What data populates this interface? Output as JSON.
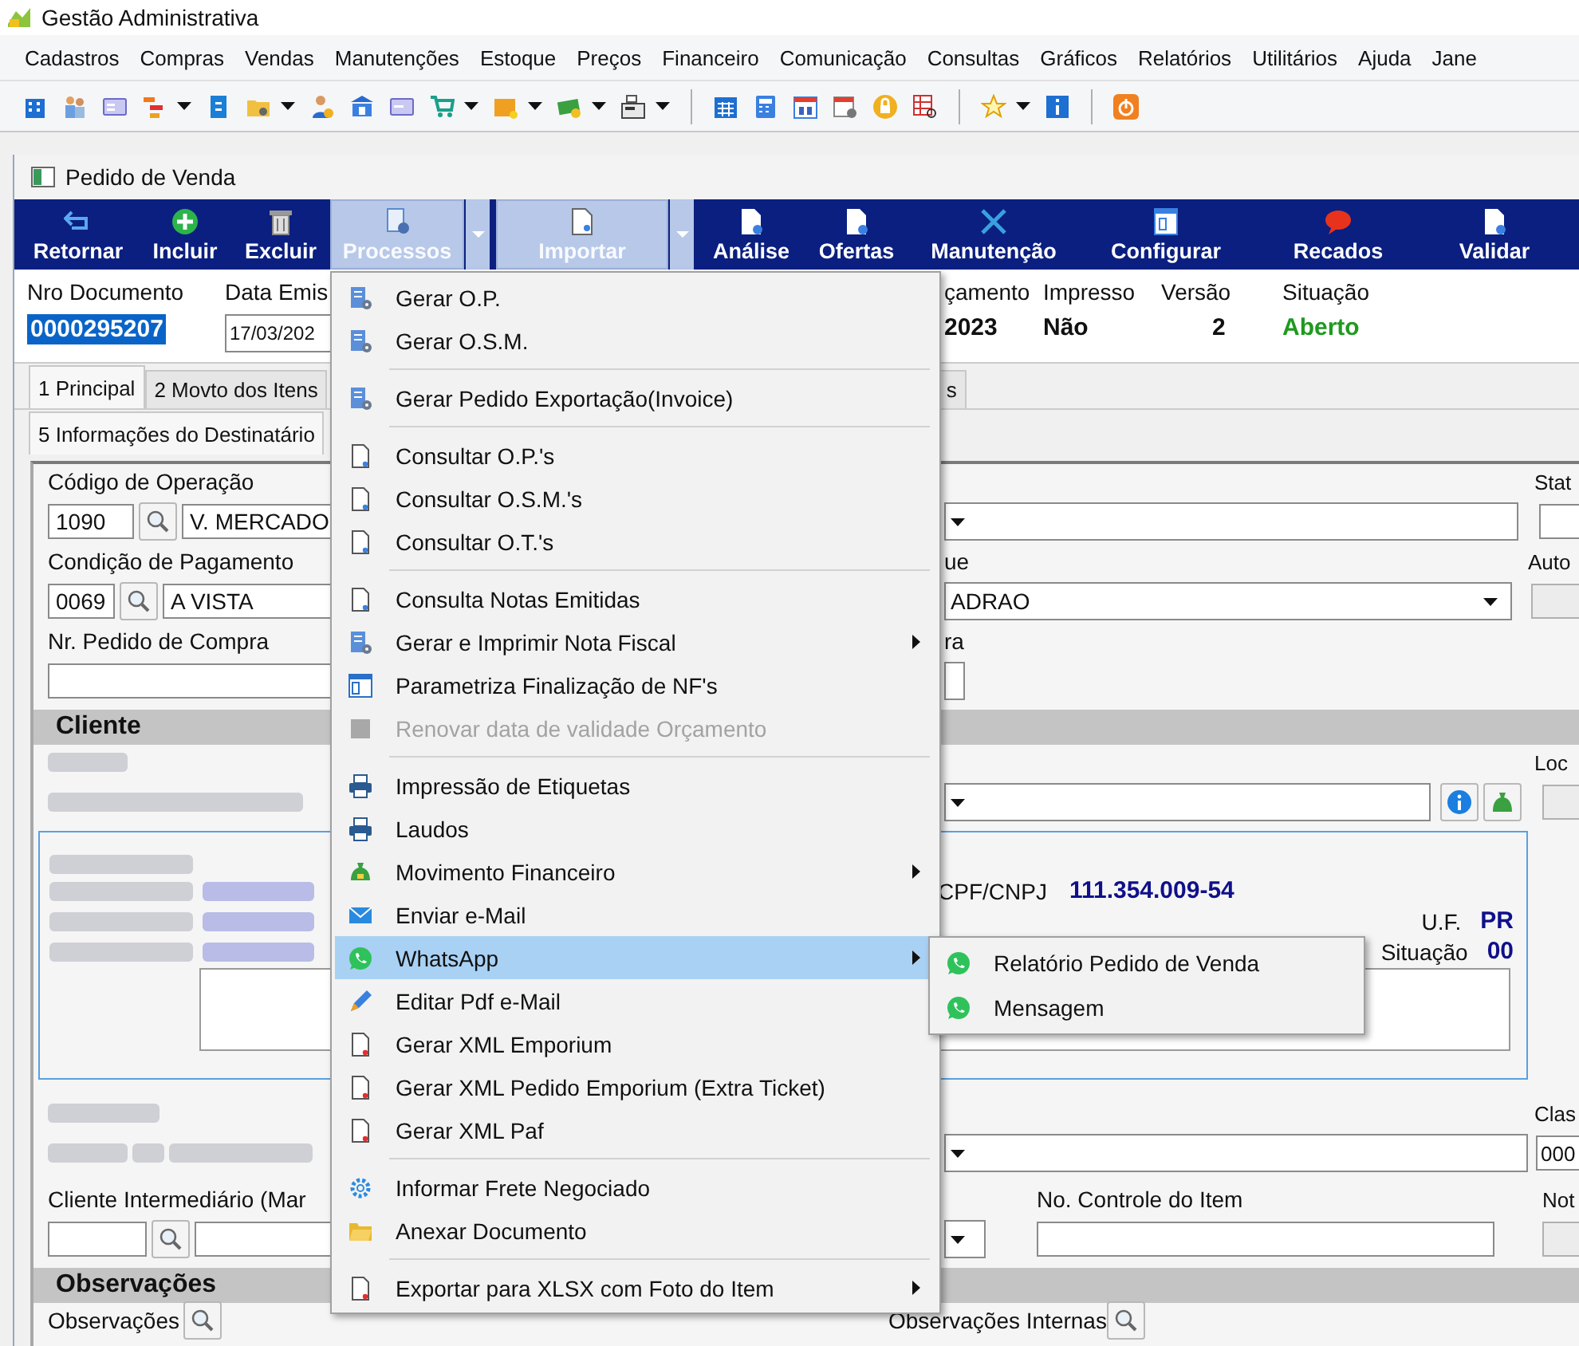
{
  "app_title": "Gestão Administrativa",
  "menu_bar": [
    "Cadastros",
    "Compras",
    "Vendas",
    "Manutenções",
    "Estoque",
    "Preços",
    "Financeiro",
    "Comunicação",
    "Consultas",
    "Gráficos",
    "Relatórios",
    "Utilitários",
    "Ajuda",
    "Jane"
  ],
  "window": {
    "title": "Pedido de Venda"
  },
  "actions": [
    {
      "label": "Retornar",
      "highlighted": false,
      "has_dropdown": false
    },
    {
      "label": "Incluir",
      "highlighted": false,
      "has_dropdown": false
    },
    {
      "label": "Excluir",
      "highlighted": false,
      "has_dropdown": false
    },
    {
      "label": "Processos",
      "highlighted": true,
      "has_dropdown": true
    },
    {
      "label": "Importar",
      "highlighted": true,
      "has_dropdown": true
    },
    {
      "label": "Análise",
      "highlighted": false,
      "has_dropdown": false
    },
    {
      "label": "Ofertas",
      "highlighted": false,
      "has_dropdown": false
    },
    {
      "label": "Manutenção",
      "highlighted": false,
      "has_dropdown": false
    },
    {
      "label": "Configurar",
      "highlighted": false,
      "has_dropdown": false
    },
    {
      "label": "Recados",
      "highlighted": false,
      "has_dropdown": false
    },
    {
      "label": "Validar",
      "highlighted": false,
      "has_dropdown": false
    }
  ],
  "header": [
    {
      "label": "Nro Documento",
      "value": "0000295207",
      "kind": "selected-text"
    },
    {
      "label": "Data Emis",
      "value": "17/03/202",
      "kind": "input"
    },
    {
      "label": "çamento",
      "value": "2023",
      "kind": "text"
    },
    {
      "label": "Impresso",
      "value": "Não",
      "kind": "text"
    },
    {
      "label": "Versão",
      "value": "2",
      "kind": "text"
    },
    {
      "label": "Situação",
      "value": "Aberto",
      "kind": "text",
      "color": "#1f9a1f"
    }
  ],
  "tabs": [
    {
      "label": "1 Principal",
      "selected": true
    },
    {
      "label": "2 Movto dos Itens",
      "selected": false
    },
    {
      "label": "s",
      "selected": false
    }
  ],
  "subtabs": [
    {
      "label": "5 Informações do Destinatário",
      "selected": true
    }
  ],
  "form": {
    "operation": {
      "label": "Código de Operação",
      "code": "1090",
      "description": "V. MERCADO"
    },
    "status_label": "Stat",
    "payment": {
      "label": "Condição de Pagamento",
      "code": "0069",
      "description": "A VISTA"
    },
    "price_label": "ue",
    "price_value": "ADRAO",
    "auto_label": "Auto",
    "purchase_order_label": "Nr. Pedido de Compra",
    "field_label": "ra",
    "client_section": "Cliente",
    "location_label": "Loc",
    "document_label": "CPF/CNPJ",
    "document": "111.354.009-54",
    "state_label": "U.F.",
    "state": "PR",
    "situation_label": "Situação",
    "situation": "00",
    "class_label": "Clas",
    "class_value": "000",
    "intermediate_label": "Cliente Intermediário (Mar",
    "item_control_label": "No. Controle do Item",
    "note_label": "Not",
    "notes_section": "Observações",
    "notes_label": "Observações",
    "internal_notes_label": "Observações Internas"
  },
  "context_menu": {
    "items": [
      {
        "kind": "item",
        "label": "Gerar O.P.",
        "disabled": false,
        "selected": false,
        "has_submenu": false
      },
      {
        "kind": "item",
        "label": "Gerar O.S.M.",
        "disabled": false,
        "selected": false,
        "has_submenu": false
      },
      {
        "kind": "separator"
      },
      {
        "kind": "item",
        "label": "Gerar Pedido Exportação(Invoice)",
        "disabled": false,
        "selected": false,
        "has_submenu": false
      },
      {
        "kind": "separator"
      },
      {
        "kind": "item",
        "label": "Consultar O.P.'s",
        "disabled": false,
        "selected": false,
        "has_submenu": false
      },
      {
        "kind": "item",
        "label": "Consultar O.S.M.'s",
        "disabled": false,
        "selected": false,
        "has_submenu": false
      },
      {
        "kind": "item",
        "label": "Consultar O.T.'s",
        "disabled": false,
        "selected": false,
        "has_submenu": false
      },
      {
        "kind": "separator"
      },
      {
        "kind": "item",
        "label": "Consulta Notas Emitidas",
        "disabled": false,
        "selected": false,
        "has_submenu": false
      },
      {
        "kind": "item",
        "label": "Gerar e Imprimir Nota Fiscal",
        "disabled": false,
        "selected": false,
        "has_submenu": true
      },
      {
        "kind": "item",
        "label": "Parametriza Finalização de NF's",
        "disabled": false,
        "selected": false,
        "has_submenu": false
      },
      {
        "kind": "item",
        "label": "Renovar data de validade Orçamento",
        "disabled": true,
        "selected": false,
        "has_submenu": false
      },
      {
        "kind": "separator"
      },
      {
        "kind": "item",
        "label": "Impressão de Etiquetas",
        "disabled": false,
        "selected": false,
        "has_submenu": false
      },
      {
        "kind": "item",
        "label": "Laudos",
        "disabled": false,
        "selected": false,
        "has_submenu": false
      },
      {
        "kind": "item",
        "label": "Movimento Financeiro",
        "disabled": false,
        "selected": false,
        "has_submenu": true
      },
      {
        "kind": "item",
        "label": "Enviar e-Mail",
        "disabled": false,
        "selected": false,
        "has_submenu": false
      },
      {
        "kind": "item",
        "label": "WhatsApp",
        "disabled": false,
        "selected": true,
        "has_submenu": true
      },
      {
        "kind": "item",
        "label": "Editar Pdf e-Mail",
        "disabled": false,
        "selected": false,
        "has_submenu": false
      },
      {
        "kind": "item",
        "label": "Gerar XML Emporium",
        "disabled": false,
        "selected": false,
        "has_submenu": false
      },
      {
        "kind": "item",
        "label": "Gerar XML Pedido Emporium (Extra Ticket)",
        "disabled": false,
        "selected": false,
        "has_submenu": false
      },
      {
        "kind": "item",
        "label": "Gerar XML Paf",
        "disabled": false,
        "selected": false,
        "has_submenu": false
      },
      {
        "kind": "separator"
      },
      {
        "kind": "item",
        "label": "Informar Frete Negociado",
        "disabled": false,
        "selected": false,
        "has_submenu": false
      },
      {
        "kind": "item",
        "label": "Anexar Documento",
        "disabled": false,
        "selected": false,
        "has_submenu": false
      },
      {
        "kind": "separator"
      },
      {
        "kind": "item",
        "label": "Exportar para XLSX com Foto do Item",
        "disabled": false,
        "selected": false,
        "has_submenu": true
      }
    ],
    "submenu": [
      {
        "label": "Relatório Pedido de Venda"
      },
      {
        "label": "Mensagem"
      }
    ]
  }
}
